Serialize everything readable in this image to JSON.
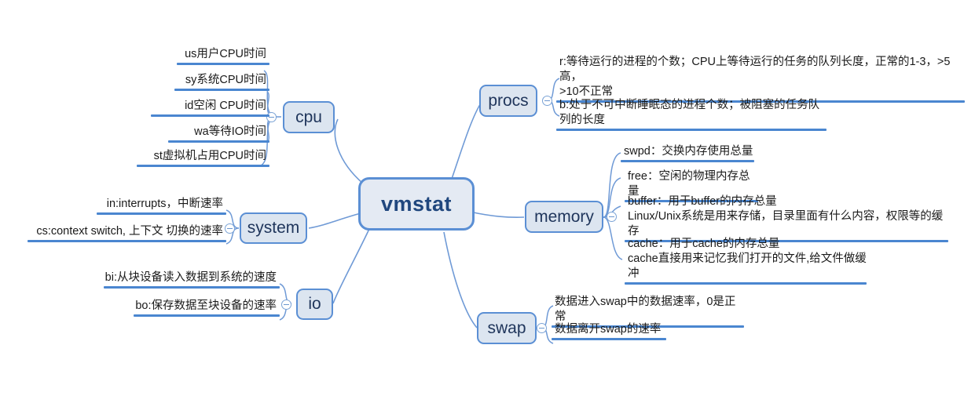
{
  "map": {
    "root": {
      "label": "vmstat"
    },
    "branches": [
      {
        "id": "cpu",
        "label": "cpu",
        "side": "left",
        "items": [
          {
            "text": "us用户CPU时间"
          },
          {
            "text": "sy系统CPU时间"
          },
          {
            "text": "id空闲 CPU时间"
          },
          {
            "text": "wa等待IO时间"
          },
          {
            "text": "st虚拟机占用CPU时间"
          }
        ]
      },
      {
        "id": "system",
        "label": "system",
        "side": "left",
        "items": [
          {
            "text": "in:interrupts，中断速率"
          },
          {
            "text": "cs:context switch, 上下文 切换的速率"
          }
        ]
      },
      {
        "id": "io",
        "label": "io",
        "side": "left",
        "items": [
          {
            "text": "bi:从块设备读入数据到系统的速度"
          },
          {
            "text": "bo:保存数据至块设备的速率"
          }
        ]
      },
      {
        "id": "procs",
        "label": "procs",
        "side": "right",
        "items": [
          {
            "text": "r:等待运行的进程的个数；CPU上等待运行的任务的队列长度，正常的1-3，>5高，\n>10不正常"
          },
          {
            "text": "b:处于不可中断睡眠态的进程个数；被阻塞的任务队列的长度"
          }
        ]
      },
      {
        "id": "memory",
        "label": "memory",
        "side": "right",
        "items": [
          {
            "text": "swpd：交换内存使用总量"
          },
          {
            "text": "free：空闲的物理内存总量"
          },
          {
            "text": "buffer：用于buffer的内存总量\nLinux/Unix系统是用来存储，目录里面有什么内容，权限等的缓存"
          },
          {
            "text": "cache：用于cache的内存总量\ncache直接用来记忆我们打开的文件,给文件做缓冲"
          }
        ]
      },
      {
        "id": "swap",
        "label": "swap",
        "side": "right",
        "items": [
          {
            "text": "数据进入swap中的数据速率，0是正常"
          },
          {
            "text": "数据离开swap的速率"
          }
        ]
      }
    ],
    "colors": {
      "node_fill": "#dce5f0",
      "node_border": "#5b8fd4",
      "line": "#6f9ad6",
      "bar": "#4a86d0",
      "root_text": "#20477e",
      "text": "#1a1a1a",
      "background": "#ffffff"
    },
    "icons": {
      "collapse": "minus-circle-icon"
    }
  }
}
